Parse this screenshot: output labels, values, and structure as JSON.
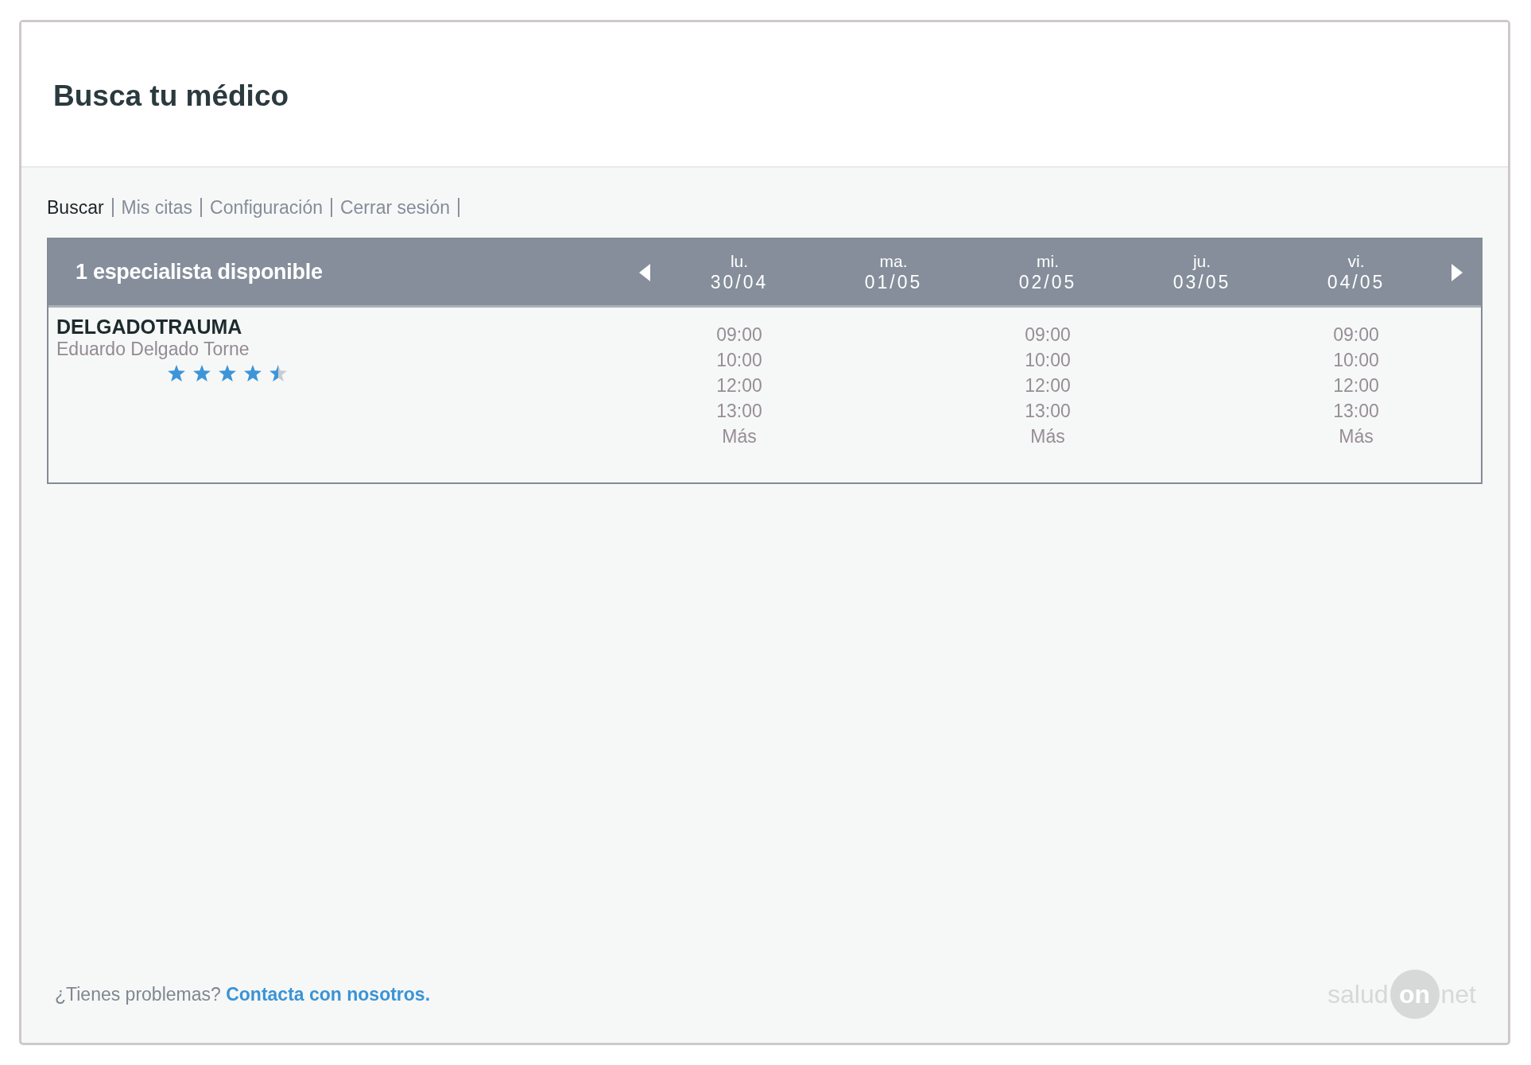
{
  "page": {
    "title": "Busca tu médico"
  },
  "nav": [
    {
      "label": "Buscar",
      "selected": true
    },
    {
      "label": "Mis citas",
      "selected": false
    },
    {
      "label": "Configuración",
      "selected": false
    },
    {
      "label": "Cerrar sesión",
      "selected": false
    }
  ],
  "results": {
    "heading": "1 especialista disponible",
    "days": [
      {
        "weekday": "lu.",
        "date": "30/04"
      },
      {
        "weekday": "ma.",
        "date": "01/05"
      },
      {
        "weekday": "mi.",
        "date": "02/05"
      },
      {
        "weekday": "ju.",
        "date": "03/05"
      },
      {
        "weekday": "vi.",
        "date": "04/05"
      }
    ],
    "doctors": [
      {
        "username": "DELGADOTRAUMA",
        "name": "Eduardo Delgado Torne",
        "stars": 4.5,
        "schedule": [
          {
            "kind": "available",
            "slots": [
              "09:00",
              "10:00",
              "12:00",
              "13:00"
            ],
            "more": "Más"
          },
          {
            "kind": "none"
          },
          {
            "kind": "available",
            "slots": [
              "09:00",
              "10:00",
              "12:00",
              "13:00"
            ],
            "more": "Más"
          },
          {
            "kind": "none"
          },
          {
            "kind": "available",
            "slots": [
              "09:00",
              "10:00",
              "12:00",
              "13:00"
            ],
            "more": "Más"
          }
        ]
      }
    ]
  },
  "footer": {
    "question": "¿Tienes problemas?",
    "link": "Contacta con nosotros.",
    "logo": [
      "salud",
      "on",
      "net"
    ]
  }
}
